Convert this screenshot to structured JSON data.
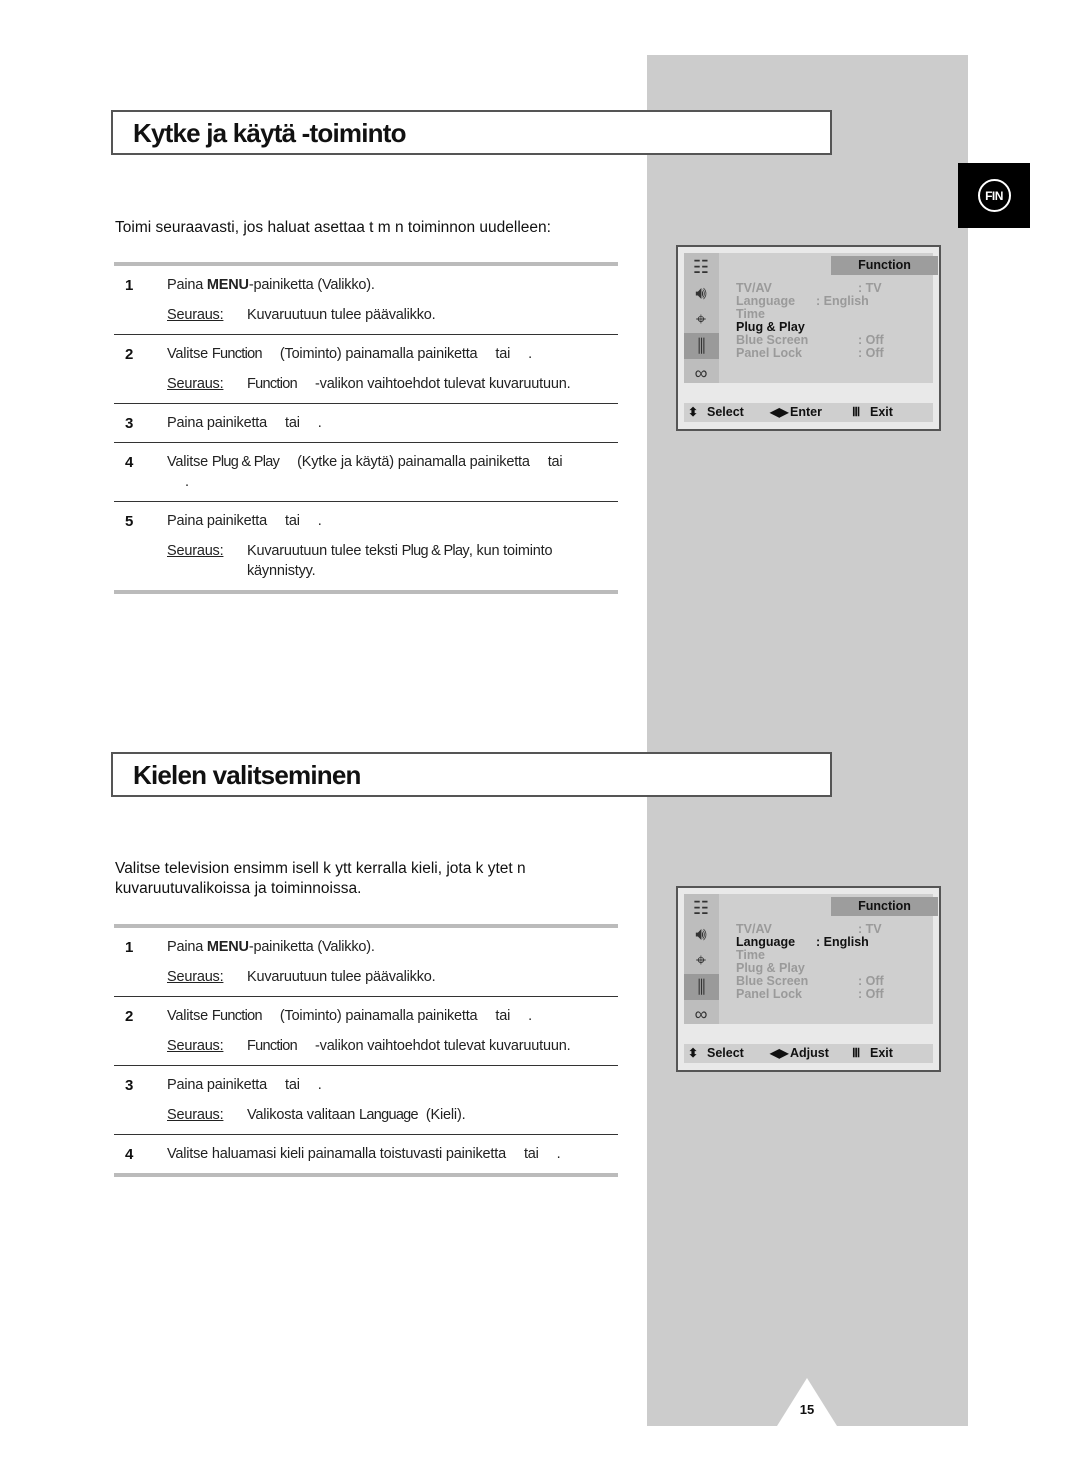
{
  "page": {
    "language_tab": "FIN",
    "page_number": "15"
  },
  "section1": {
    "title": "Kytke ja käytä -toiminto",
    "intro": "Toimi seuraavasti, jos haluat asettaa t m n toiminnon uudelleen:",
    "steps": [
      {
        "num": "1",
        "pre": "Paina ",
        "bold": "MENU",
        "post": "-painiketta (Valikko).",
        "result_label": "Seuraus:",
        "result": "Kuvaruutuun tulee päävalikko."
      },
      {
        "num": "2",
        "a": "Valitse ",
        "cond": "Function",
        "b": "(Toiminto) painamalla painiketta",
        "c": "tai",
        "d": ".",
        "result_label": "Seuraus:",
        "result_cond": "Function",
        "result": "-valikon vaihtoehdot tulevat kuvaruutuun."
      },
      {
        "num": "3",
        "a": "Paina painiketta",
        "c": "tai",
        "d": "."
      },
      {
        "num": "4",
        "a": "Valitse ",
        "cond": "Plug & Play",
        "b": "(Kytke ja käytä) painamalla painiketta",
        "c": "tai",
        "d": "."
      },
      {
        "num": "5",
        "a": "Paina painiketta",
        "c": "tai",
        "d": ".",
        "result_label": "Seuraus:",
        "result_a": "Kuvaruutuun tulee teksti ",
        "result_cond": "Plug & Play",
        "result_b": ", kun toiminto käynnistyy."
      }
    ]
  },
  "section2": {
    "title": "Kielen valitseminen",
    "intro_line1": "Valitse television ensimm isell  k ytt kerralla kieli, jota k ytet  n",
    "intro_line2": "kuvaruutuvalikoissa ja toiminnoissa.",
    "steps": [
      {
        "num": "1",
        "pre": "Paina ",
        "bold": "MENU",
        "post": "-painiketta (Valikko).",
        "result_label": "Seuraus:",
        "result": "Kuvaruutuun tulee päävalikko."
      },
      {
        "num": "2",
        "a": "Valitse ",
        "cond": "Function",
        "b": "(Toiminto) painamalla painiketta",
        "c": "tai",
        "d": ".",
        "result_label": "Seuraus:",
        "result_cond": "Function",
        "result": "-valikon vaihtoehdot tulevat kuvaruutuun."
      },
      {
        "num": "3",
        "a": "Paina painiketta",
        "c": "tai",
        "d": ".",
        "result_label": "Seuraus:",
        "result_a": "Valikosta valitaan ",
        "result_cond": "Language",
        "result_b": "(Kieli)."
      },
      {
        "num": "4",
        "a": "Valitse haluamasi kieli painamalla toistuvasti painiketta",
        "c": "tai",
        "d": "."
      }
    ]
  },
  "osd1": {
    "header": "Function",
    "items": [
      {
        "label": "TV/AV",
        "value": ": TV"
      },
      {
        "label": "Language",
        "value": ": English"
      },
      {
        "label": "Time",
        "value": ""
      },
      {
        "label": "Plug & Play",
        "value": "",
        "active": true
      },
      {
        "label": "Blue Screen",
        "value": ": Off"
      },
      {
        "label": "Panel Lock",
        "value": ": Off"
      }
    ],
    "footer": {
      "select": "Select",
      "action": "Enter",
      "exit": "Exit"
    }
  },
  "osd2": {
    "header": "Function",
    "items": [
      {
        "label": "TV/AV",
        "value": ": TV"
      },
      {
        "label": "Language",
        "value": ": English",
        "active": true
      },
      {
        "label": "Time",
        "value": ""
      },
      {
        "label": "Plug & Play",
        "value": ""
      },
      {
        "label": "Blue Screen",
        "value": ": Off"
      },
      {
        "label": "Panel Lock",
        "value": ": Off"
      }
    ],
    "footer": {
      "select": "Select",
      "action": "Adjust",
      "exit": "Exit"
    }
  },
  "colors": {
    "side_column": "#cccccc",
    "osd_highlight": "#9d9d9d",
    "osd_inactive_text": "#9a9a9a"
  }
}
